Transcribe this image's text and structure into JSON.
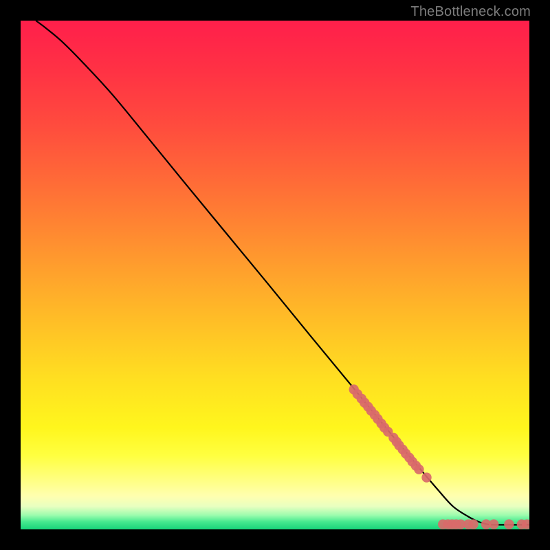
{
  "watermark": "TheBottleneck.com",
  "colors": {
    "curve": "#000000",
    "dot_fill": "#d96a6a",
    "dot_stroke": "#d96a6a",
    "background": "#000000"
  },
  "gradient_stops": [
    {
      "offset": 0.0,
      "color": "#ff1f4b"
    },
    {
      "offset": 0.1,
      "color": "#ff3244"
    },
    {
      "offset": 0.2,
      "color": "#ff4a3e"
    },
    {
      "offset": 0.3,
      "color": "#ff6638"
    },
    {
      "offset": 0.4,
      "color": "#ff8432"
    },
    {
      "offset": 0.5,
      "color": "#ffa32c"
    },
    {
      "offset": 0.6,
      "color": "#ffc126"
    },
    {
      "offset": 0.7,
      "color": "#ffde21"
    },
    {
      "offset": 0.8,
      "color": "#fff61d"
    },
    {
      "offset": 0.855,
      "color": "#ffff40"
    },
    {
      "offset": 0.905,
      "color": "#ffff85"
    },
    {
      "offset": 0.935,
      "color": "#ffffb0"
    },
    {
      "offset": 0.955,
      "color": "#e8ffc0"
    },
    {
      "offset": 0.972,
      "color": "#9dfcae"
    },
    {
      "offset": 0.985,
      "color": "#47e98f"
    },
    {
      "offset": 1.0,
      "color": "#18d47a"
    }
  ],
  "chart_data": {
    "type": "line",
    "title": "",
    "xlabel": "",
    "ylabel": "",
    "xlim": [
      0,
      100
    ],
    "ylim": [
      0,
      100
    ],
    "grid": false,
    "series": [
      {
        "name": "curve",
        "x": [
          3,
          5,
          8,
          12,
          18,
          25,
          33,
          41,
          49,
          57,
          65,
          73,
          78,
          82,
          85,
          88,
          90,
          92,
          94,
          96,
          98,
          100
        ],
        "y": [
          100,
          98.5,
          96,
          92,
          85.5,
          77,
          67.2,
          57.5,
          47.8,
          38,
          28.3,
          18.5,
          12.5,
          7.8,
          4.5,
          2.5,
          1.5,
          0.95,
          0.9,
          0.9,
          0.9,
          0.9
        ]
      }
    ],
    "scatter": {
      "name": "dots",
      "points": [
        {
          "x": 65.5,
          "y": 27.5
        },
        {
          "x": 66.2,
          "y": 26.6
        },
        {
          "x": 67.0,
          "y": 25.7
        },
        {
          "x": 67.6,
          "y": 24.9
        },
        {
          "x": 68.3,
          "y": 24.1
        },
        {
          "x": 68.9,
          "y": 23.3
        },
        {
          "x": 69.6,
          "y": 22.5
        },
        {
          "x": 70.2,
          "y": 21.7
        },
        {
          "x": 70.9,
          "y": 20.8
        },
        {
          "x": 71.5,
          "y": 20.0
        },
        {
          "x": 72.2,
          "y": 19.2
        },
        {
          "x": 73.3,
          "y": 18.0
        },
        {
          "x": 73.9,
          "y": 17.2
        },
        {
          "x": 74.4,
          "y": 16.5
        },
        {
          "x": 75.1,
          "y": 15.7
        },
        {
          "x": 75.7,
          "y": 14.9
        },
        {
          "x": 76.4,
          "y": 14.1
        },
        {
          "x": 77.0,
          "y": 13.3
        },
        {
          "x": 77.7,
          "y": 12.5
        },
        {
          "x": 78.3,
          "y": 11.8
        },
        {
          "x": 79.8,
          "y": 10.2
        },
        {
          "x": 83.0,
          "y": 1.0
        },
        {
          "x": 84.0,
          "y": 1.0
        },
        {
          "x": 84.8,
          "y": 1.0
        },
        {
          "x": 85.6,
          "y": 1.0
        },
        {
          "x": 86.5,
          "y": 1.0
        },
        {
          "x": 88.0,
          "y": 1.0
        },
        {
          "x": 89.0,
          "y": 1.0
        },
        {
          "x": 91.5,
          "y": 1.0
        },
        {
          "x": 93.0,
          "y": 1.0
        },
        {
          "x": 96.0,
          "y": 1.0
        },
        {
          "x": 98.5,
          "y": 1.0
        },
        {
          "x": 99.5,
          "y": 1.0
        }
      ]
    }
  }
}
